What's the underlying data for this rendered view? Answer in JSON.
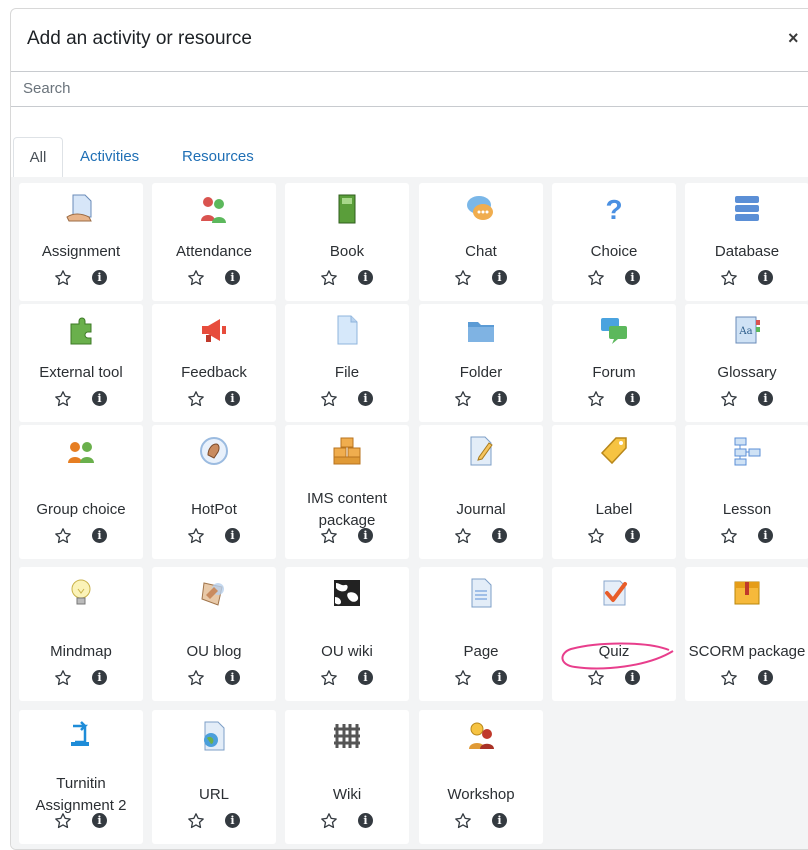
{
  "dialog": {
    "title": "Add an activity or resource",
    "close_label": "×",
    "search_placeholder": "Search",
    "tabs": [
      {
        "label": "All",
        "active": true
      },
      {
        "label": "Activities",
        "active": false
      },
      {
        "label": "Resources",
        "active": false
      }
    ]
  },
  "colors": {
    "tab_link": "#1f6fb5",
    "annotation_circle": "#e83e8c",
    "tile_background": "#f3f4f5"
  },
  "items": [
    {
      "name": "Assignment",
      "icon": "assignment-icon"
    },
    {
      "name": "Attendance",
      "icon": "attendance-icon"
    },
    {
      "name": "Book",
      "icon": "book-icon"
    },
    {
      "name": "Chat",
      "icon": "chat-icon"
    },
    {
      "name": "Choice",
      "icon": "choice-icon"
    },
    {
      "name": "Database",
      "icon": "database-icon"
    },
    {
      "name": "External tool",
      "icon": "external-tool-icon"
    },
    {
      "name": "Feedback",
      "icon": "feedback-icon"
    },
    {
      "name": "File",
      "icon": "file-icon"
    },
    {
      "name": "Folder",
      "icon": "folder-icon"
    },
    {
      "name": "Forum",
      "icon": "forum-icon"
    },
    {
      "name": "Glossary",
      "icon": "glossary-icon"
    },
    {
      "name": "Group choice",
      "icon": "group-choice-icon"
    },
    {
      "name": "HotPot",
      "icon": "hotpot-icon"
    },
    {
      "name": "IMS content package",
      "icon": "ims-package-icon"
    },
    {
      "name": "Journal",
      "icon": "journal-icon"
    },
    {
      "name": "Label",
      "icon": "label-icon"
    },
    {
      "name": "Lesson",
      "icon": "lesson-icon"
    },
    {
      "name": "Mindmap",
      "icon": "mindmap-icon"
    },
    {
      "name": "OU blog",
      "icon": "ou-blog-icon"
    },
    {
      "name": "OU wiki",
      "icon": "ou-wiki-icon"
    },
    {
      "name": "Page",
      "icon": "page-icon"
    },
    {
      "name": "Quiz",
      "icon": "quiz-icon"
    },
    {
      "name": "SCORM package",
      "icon": "scorm-icon"
    },
    {
      "name": "Turnitin Assignment 2",
      "icon": "turnitin-icon"
    },
    {
      "name": "URL",
      "icon": "url-icon"
    },
    {
      "name": "Wiki",
      "icon": "wiki-icon"
    },
    {
      "name": "Workshop",
      "icon": "workshop-icon"
    }
  ],
  "actions": {
    "star_icon": "star-icon",
    "info_icon": "info-icon",
    "info_glyph": "i"
  }
}
